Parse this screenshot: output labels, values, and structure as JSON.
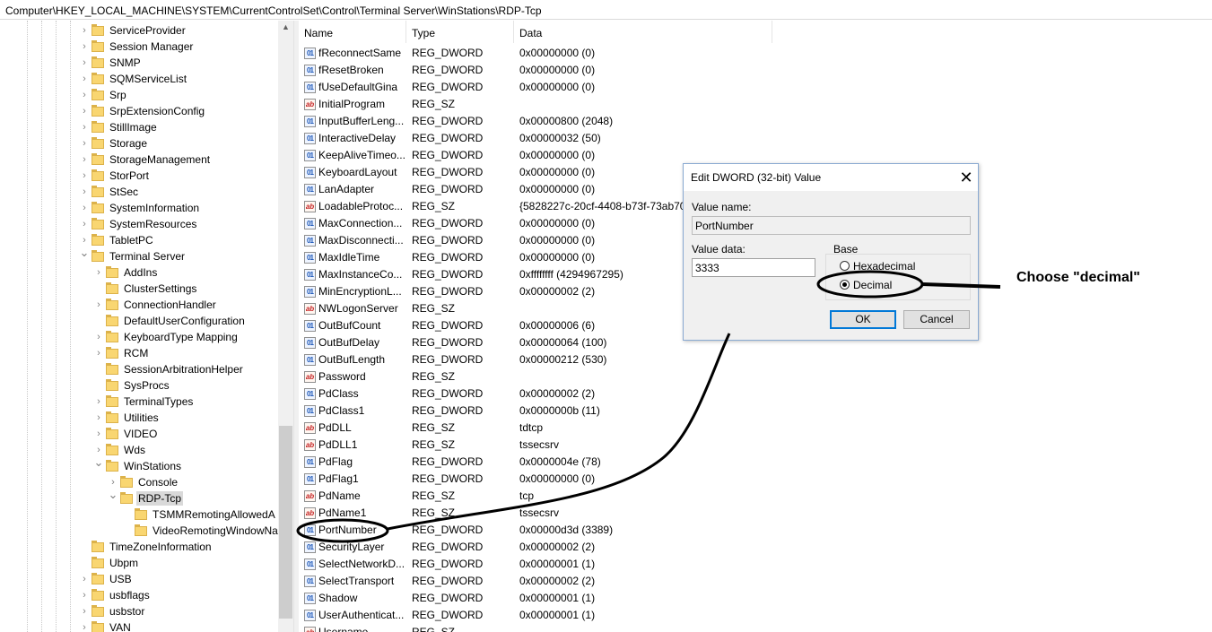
{
  "address_bar": {
    "path": "Computer\\HKEY_LOCAL_MACHINE\\SYSTEM\\CurrentControlSet\\Control\\Terminal Server\\WinStations\\RDP-Tcp"
  },
  "tree": {
    "items": [
      {
        "label": "ServiceProvider",
        "level": 0,
        "exp": ">"
      },
      {
        "label": "Session Manager",
        "level": 0,
        "exp": ">"
      },
      {
        "label": "SNMP",
        "level": 0,
        "exp": ">"
      },
      {
        "label": "SQMServiceList",
        "level": 0,
        "exp": ">"
      },
      {
        "label": "Srp",
        "level": 0,
        "exp": ">"
      },
      {
        "label": "SrpExtensionConfig",
        "level": 0,
        "exp": ">"
      },
      {
        "label": "StillImage",
        "level": 0,
        "exp": ">"
      },
      {
        "label": "Storage",
        "level": 0,
        "exp": ">"
      },
      {
        "label": "StorageManagement",
        "level": 0,
        "exp": ">"
      },
      {
        "label": "StorPort",
        "level": 0,
        "exp": ">"
      },
      {
        "label": "StSec",
        "level": 0,
        "exp": ">"
      },
      {
        "label": "SystemInformation",
        "level": 0,
        "exp": ">"
      },
      {
        "label": "SystemResources",
        "level": 0,
        "exp": ">"
      },
      {
        "label": "TabletPC",
        "level": 0,
        "exp": ">"
      },
      {
        "label": "Terminal Server",
        "level": 0,
        "exp": "v"
      },
      {
        "label": "AddIns",
        "level": 1,
        "exp": ">"
      },
      {
        "label": "ClusterSettings",
        "level": 1,
        "exp": ""
      },
      {
        "label": "ConnectionHandler",
        "level": 1,
        "exp": ">"
      },
      {
        "label": "DefaultUserConfiguration",
        "level": 1,
        "exp": ""
      },
      {
        "label": "KeyboardType Mapping",
        "level": 1,
        "exp": ">"
      },
      {
        "label": "RCM",
        "level": 1,
        "exp": ">"
      },
      {
        "label": "SessionArbitrationHelper",
        "level": 1,
        "exp": ""
      },
      {
        "label": "SysProcs",
        "level": 1,
        "exp": ""
      },
      {
        "label": "TerminalTypes",
        "level": 1,
        "exp": ">"
      },
      {
        "label": "Utilities",
        "level": 1,
        "exp": ">"
      },
      {
        "label": "VIDEO",
        "level": 1,
        "exp": ">"
      },
      {
        "label": "Wds",
        "level": 1,
        "exp": ">"
      },
      {
        "label": "WinStations",
        "level": 1,
        "exp": "v"
      },
      {
        "label": "Console",
        "level": 2,
        "exp": ">"
      },
      {
        "label": "RDP-Tcp",
        "level": 2,
        "exp": "v",
        "selected": true
      },
      {
        "label": "TSMMRemotingAllowedA",
        "level": 3,
        "exp": ""
      },
      {
        "label": "VideoRemotingWindowNa",
        "level": 3,
        "exp": ""
      },
      {
        "label": "TimeZoneInformation",
        "level": 0,
        "exp": ""
      },
      {
        "label": "Ubpm",
        "level": 0,
        "exp": ""
      },
      {
        "label": "USB",
        "level": 0,
        "exp": ">"
      },
      {
        "label": "usbflags",
        "level": 0,
        "exp": ">"
      },
      {
        "label": "usbstor",
        "level": 0,
        "exp": ">"
      },
      {
        "label": "VAN",
        "level": 0,
        "exp": ">"
      }
    ]
  },
  "list": {
    "headers": {
      "name": "Name",
      "type": "Type",
      "data": "Data"
    },
    "rows": [
      {
        "name": "fReconnectSame",
        "type": "REG_DWORD",
        "data": "0x00000000 (0)"
      },
      {
        "name": "fResetBroken",
        "type": "REG_DWORD",
        "data": "0x00000000 (0)"
      },
      {
        "name": "fUseDefaultGina",
        "type": "REG_DWORD",
        "data": "0x00000000 (0)"
      },
      {
        "name": "InitialProgram",
        "type": "REG_SZ",
        "data": ""
      },
      {
        "name": "InputBufferLeng...",
        "type": "REG_DWORD",
        "data": "0x00000800 (2048)"
      },
      {
        "name": "InteractiveDelay",
        "type": "REG_DWORD",
        "data": "0x00000032 (50)"
      },
      {
        "name": "KeepAliveTimeo...",
        "type": "REG_DWORD",
        "data": "0x00000000 (0)"
      },
      {
        "name": "KeyboardLayout",
        "type": "REG_DWORD",
        "data": "0x00000000 (0)"
      },
      {
        "name": "LanAdapter",
        "type": "REG_DWORD",
        "data": "0x00000000 (0)"
      },
      {
        "name": "LoadableProtoc...",
        "type": "REG_SZ",
        "data": "{5828227c-20cf-4408-b73f-73ab70b"
      },
      {
        "name": "MaxConnection...",
        "type": "REG_DWORD",
        "data": "0x00000000 (0)"
      },
      {
        "name": "MaxDisconnecti...",
        "type": "REG_DWORD",
        "data": "0x00000000 (0)"
      },
      {
        "name": "MaxIdleTime",
        "type": "REG_DWORD",
        "data": "0x00000000 (0)"
      },
      {
        "name": "MaxInstanceCo...",
        "type": "REG_DWORD",
        "data": "0xffffffff (4294967295)"
      },
      {
        "name": "MinEncryptionL...",
        "type": "REG_DWORD",
        "data": "0x00000002 (2)"
      },
      {
        "name": "NWLogonServer",
        "type": "REG_SZ",
        "data": ""
      },
      {
        "name": "OutBufCount",
        "type": "REG_DWORD",
        "data": "0x00000006 (6)"
      },
      {
        "name": "OutBufDelay",
        "type": "REG_DWORD",
        "data": "0x00000064 (100)"
      },
      {
        "name": "OutBufLength",
        "type": "REG_DWORD",
        "data": "0x00000212 (530)"
      },
      {
        "name": "Password",
        "type": "REG_SZ",
        "data": ""
      },
      {
        "name": "PdClass",
        "type": "REG_DWORD",
        "data": "0x00000002 (2)"
      },
      {
        "name": "PdClass1",
        "type": "REG_DWORD",
        "data": "0x0000000b (11)"
      },
      {
        "name": "PdDLL",
        "type": "REG_SZ",
        "data": "tdtcp"
      },
      {
        "name": "PdDLL1",
        "type": "REG_SZ",
        "data": "tssecsrv"
      },
      {
        "name": "PdFlag",
        "type": "REG_DWORD",
        "data": "0x0000004e (78)"
      },
      {
        "name": "PdFlag1",
        "type": "REG_DWORD",
        "data": "0x00000000 (0)"
      },
      {
        "name": "PdName",
        "type": "REG_SZ",
        "data": "tcp"
      },
      {
        "name": "PdName1",
        "type": "REG_SZ",
        "data": "tssecsrv"
      },
      {
        "name": "PortNumber",
        "type": "REG_DWORD",
        "data": "0x00000d3d (3389)"
      },
      {
        "name": "SecurityLayer",
        "type": "REG_DWORD",
        "data": "0x00000002 (2)"
      },
      {
        "name": "SelectNetworkD...",
        "type": "REG_DWORD",
        "data": "0x00000001 (1)"
      },
      {
        "name": "SelectTransport",
        "type": "REG_DWORD",
        "data": "0x00000002 (2)"
      },
      {
        "name": "Shadow",
        "type": "REG_DWORD",
        "data": "0x00000001 (1)"
      },
      {
        "name": "UserAuthenticat...",
        "type": "REG_DWORD",
        "data": "0x00000001 (1)"
      },
      {
        "name": "Username",
        "type": "REG_SZ",
        "data": ""
      }
    ]
  },
  "dialog": {
    "title": "Edit DWORD (32-bit) Value",
    "value_name_label": "Value name:",
    "value_name": "PortNumber",
    "value_data_label": "Value data:",
    "value_data": "3333",
    "base_label": "Base",
    "hex_label": "Hexadecimal",
    "dec_label": "Decimal",
    "selected_base": "Decimal",
    "ok_label": "OK",
    "cancel_label": "Cancel",
    "close_glyph": "✕"
  },
  "annotation": {
    "note": "Choose \"decimal\""
  },
  "colors": {
    "folder": "#f9d671",
    "selection": "#d9d9d9",
    "default_button_border": "#0078d7",
    "dword_icon": "#1e58b8",
    "sz_icon": "#c42020"
  }
}
